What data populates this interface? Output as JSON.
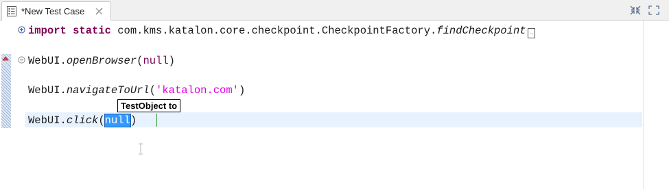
{
  "tab": {
    "title": "*New Test Case",
    "icon": "test-case-icon",
    "close_icon": "close-icon"
  },
  "window_controls": {
    "minimize_icon": "minimize-icon",
    "maximize_icon": "maximize-icon"
  },
  "code": {
    "line1": {
      "import_kw": "import",
      "static_kw": "static",
      "path": " com.kms.katalon.core.checkpoint.CheckpointFactory.",
      "method": "findCheckpoint",
      "ellipsis": ".."
    },
    "line2": {
      "obj": "WebUI.",
      "method": "openBrowser",
      "open": "(",
      "arg": "null",
      "close": ")"
    },
    "line3": {
      "obj": "WebUI.",
      "method": "navigateToUrl",
      "open": "(",
      "arg": "'katalon.com'",
      "close": ")"
    },
    "line4": {
      "obj": "WebUI.",
      "method": "click",
      "open": "(",
      "arg": "null",
      "close": ")"
    }
  },
  "tooltip": {
    "text": "TestObject to"
  },
  "colors": {
    "keyword": "#7f0055",
    "string": "#e000e0",
    "selection": "#3399ff",
    "current_line": "#e8f2fe"
  }
}
